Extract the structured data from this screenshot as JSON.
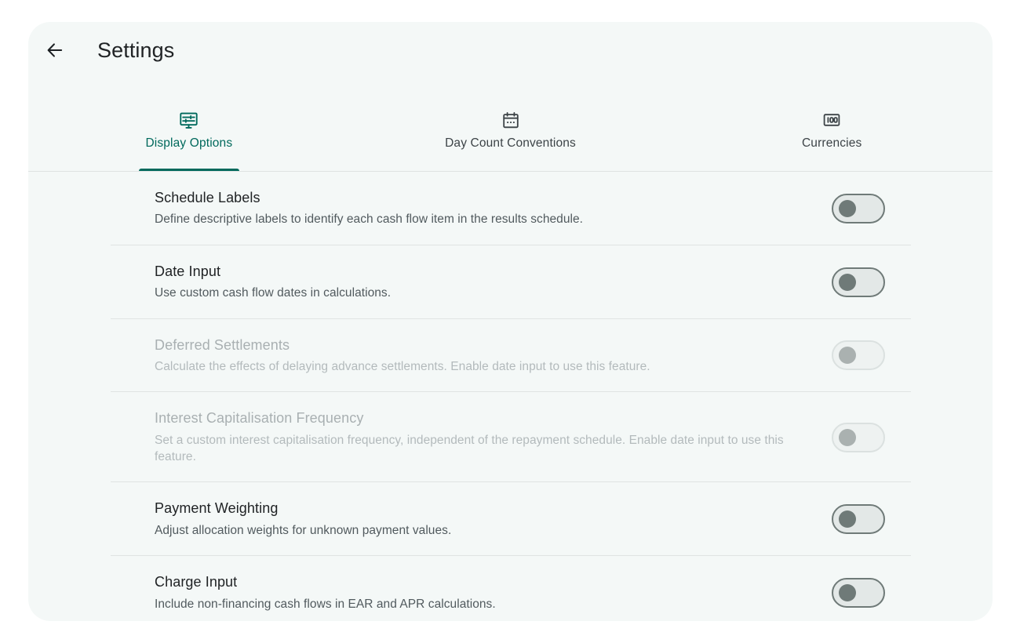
{
  "header": {
    "title": "Settings",
    "back_icon": "arrow-left-icon"
  },
  "theme": {
    "accent": "#00695c",
    "card_background": "#f4f8f7",
    "page_background": "#ffffff",
    "title_text": "#202325",
    "body_text": "#515a5e",
    "disabled_text": "#a9b0b2",
    "divider": "#e0e4e3",
    "toggle_off_border": "#6f7a78",
    "toggle_off_knob": "#6f7a78",
    "toggle_disabled_border": "#dbe1e0",
    "toggle_disabled_knob": "#aab1b0"
  },
  "tabs": [
    {
      "label": "Display Options",
      "icon": "display-settings-icon",
      "active": true
    },
    {
      "label": "Day Count Conventions",
      "icon": "calendar-icon",
      "active": false
    },
    {
      "label": "Currencies",
      "icon": "banknote-100-icon",
      "active": false
    }
  ],
  "settings": [
    {
      "title": "Schedule Labels",
      "description": "Define descriptive labels to identify each cash flow item in the results schedule.",
      "enabled": true,
      "toggle_state": "off"
    },
    {
      "title": "Date Input",
      "description": "Use custom cash flow dates in calculations.",
      "enabled": true,
      "toggle_state": "off"
    },
    {
      "title": "Deferred Settlements",
      "description": "Calculate the effects of delaying advance settlements. Enable date input to use this feature.",
      "enabled": false,
      "toggle_state": "off"
    },
    {
      "title": "Interest Capitalisation Frequency",
      "description": "Set a custom interest capitalisation frequency, independent of the repayment schedule. Enable date input to use this feature.",
      "enabled": false,
      "toggle_state": "off"
    },
    {
      "title": "Payment Weighting",
      "description": "Adjust allocation weights for unknown payment values.",
      "enabled": true,
      "toggle_state": "off"
    },
    {
      "title": "Charge Input",
      "description": "Include non-financing cash flows in EAR and APR calculations.",
      "enabled": true,
      "toggle_state": "off"
    }
  ]
}
